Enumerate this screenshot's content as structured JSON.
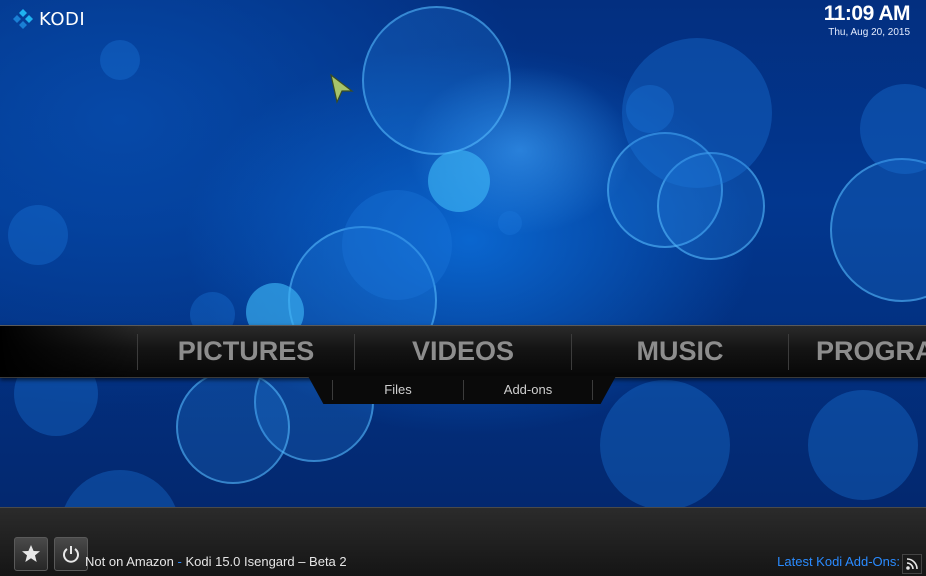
{
  "app": {
    "logo_text": "KODI",
    "logo_colors": [
      "#1fb2f0",
      "#1a7fd4"
    ]
  },
  "clock": {
    "time": "11:09 AM",
    "date": "Thu, Aug 20, 2015"
  },
  "main_menu": {
    "items": [
      {
        "label": "PICTURES"
      },
      {
        "label": "VIDEOS",
        "selected": true
      },
      {
        "label": "MUSIC"
      },
      {
        "label": "PROGRA"
      }
    ]
  },
  "sub_menu": {
    "items": [
      {
        "label": "Files"
      },
      {
        "label": "Add-ons"
      }
    ]
  },
  "footer": {
    "favourites_icon": "star-icon",
    "power_icon": "power-icon",
    "ticker": {
      "prefix": "Not on Amazon",
      "separator": " - ",
      "text": "Kodi 15.0 Isengard – Beta 2"
    },
    "latest_label": "Latest Kodi Add-Ons:",
    "rss_icon": "rss-icon",
    "accent_color": "#2a8bff"
  }
}
